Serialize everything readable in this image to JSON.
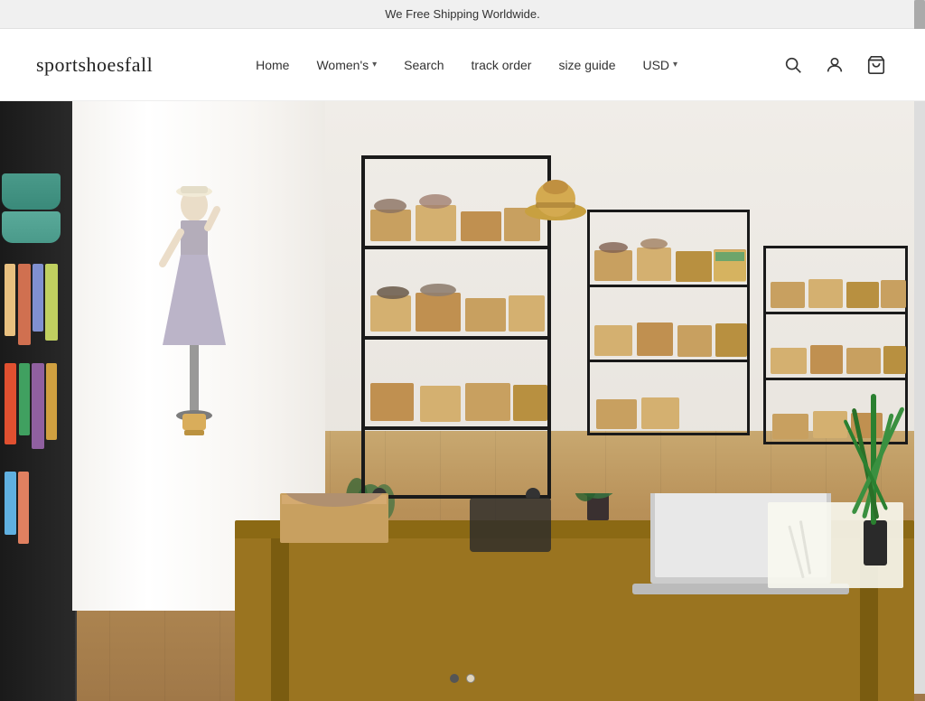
{
  "announcement": {
    "text": "We Free Shipping Worldwide."
  },
  "header": {
    "logo": "sportshoesfall",
    "nav": {
      "home": "Home",
      "womens": "Women's",
      "search": "Search",
      "track_order": "track order",
      "size_guide": "size guide"
    },
    "currency": "USD",
    "currency_dropdown": "▾"
  },
  "hero": {
    "alt": "Shoe store interior with clothing racks, shoe shelves, and a display table"
  },
  "carousel": {
    "dots": [
      {
        "active": true,
        "index": 1
      },
      {
        "active": false,
        "index": 2
      }
    ]
  }
}
